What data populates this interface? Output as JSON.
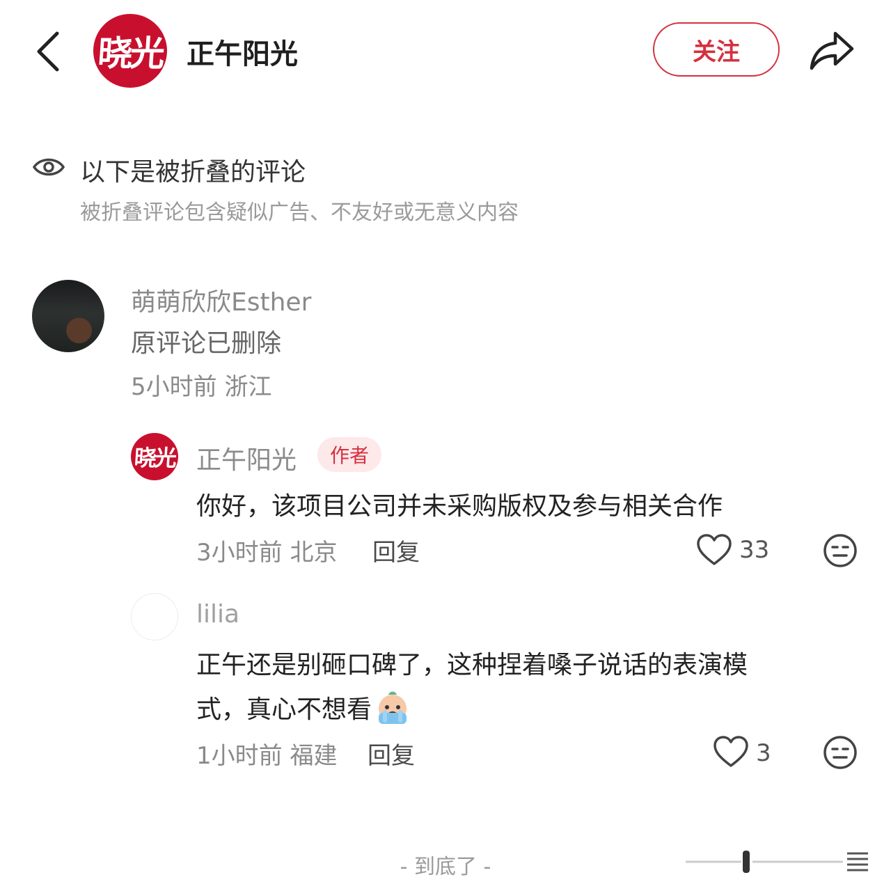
{
  "header": {
    "back_icon": "chevron-left-icon",
    "logo_glyph": "晓光",
    "title": "正午阳光",
    "follow_label": "关注",
    "share_icon": "share-arrow-icon",
    "accent_color": "#d5303f",
    "logo_color": "#c8102e"
  },
  "folded": {
    "icon": "eye-icon",
    "title": "以下是被折叠的评论",
    "subtitle": "被折叠评论包含疑似广告、不友好或无意义内容"
  },
  "comment": {
    "author": "萌萌欣欣Esther",
    "text": "原评论已删除",
    "meta": "5小时前 浙江"
  },
  "replies": [
    {
      "author": "正午阳光",
      "badge": "作者",
      "text": "你好，该项目公司并未采购版权及参与相关合作",
      "meta": "3小时前 北京",
      "reply_label": "回复",
      "likes": "33"
    },
    {
      "author": "lilia",
      "text_line1": "正午还是别砸口碑了，这种捏着嗓子说话的表演模",
      "text_line2": "式，真心不想看",
      "emoji": "crying-emoji-icon",
      "meta": "1小时前 福建",
      "reply_label": "回复",
      "likes": "3"
    }
  ],
  "footer": {
    "end_text": "- 到底了 -"
  }
}
